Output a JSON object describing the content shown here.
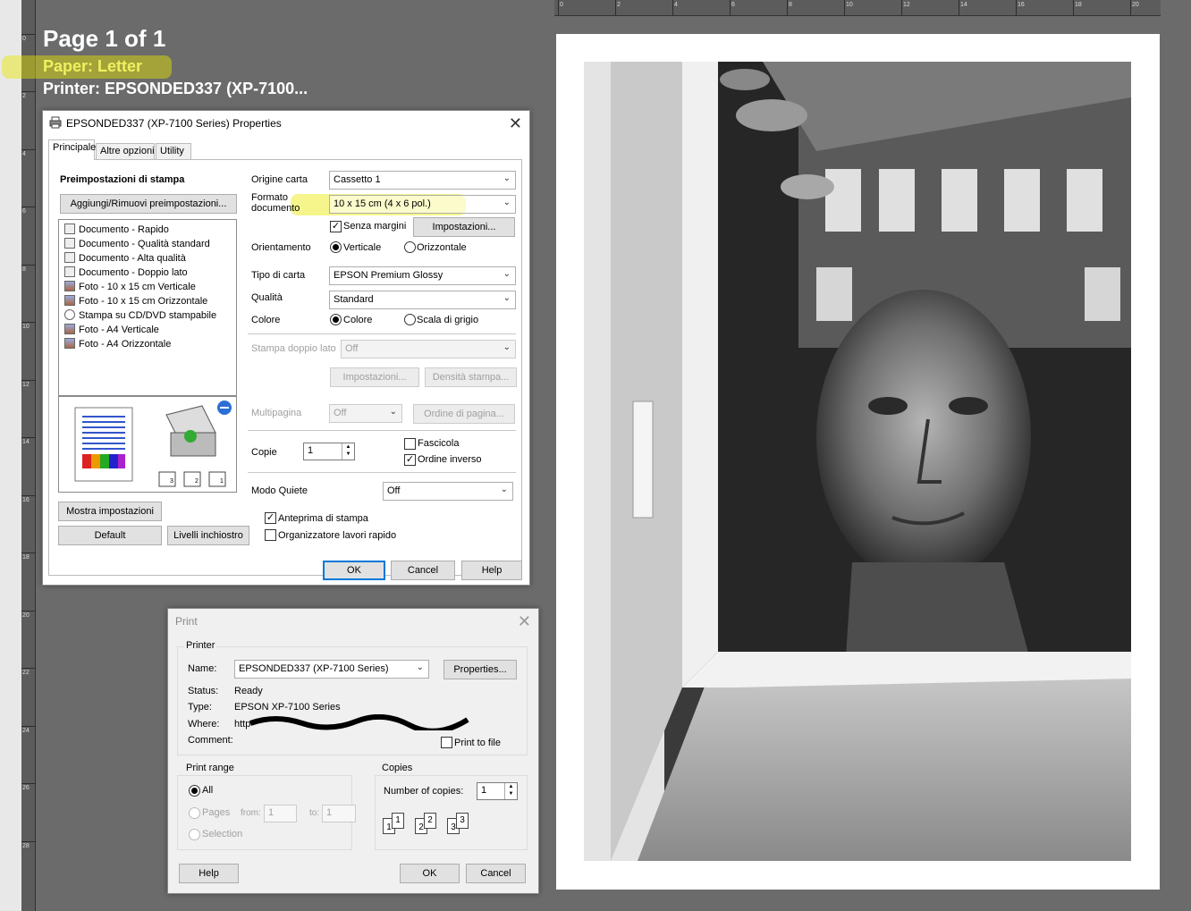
{
  "preview": {
    "page_info": "Page 1 of 1",
    "paper": "Paper:  Letter",
    "printer": "Printer:  EPSONDED337 (XP-7100..."
  },
  "vertical_ruler": [
    "0",
    "2",
    "4",
    "6",
    "8",
    "10",
    "12",
    "14",
    "16",
    "18",
    "20",
    "22",
    "24",
    "26",
    "28"
  ],
  "horizontal_ruler": [
    "0",
    "2",
    "4",
    "6",
    "8",
    "10",
    "12",
    "14",
    "16",
    "18",
    "20"
  ],
  "colors": {
    "highlight": "#e8e800",
    "accent": "#0078d7",
    "canvas": "#6b6b6b"
  },
  "properties": {
    "title": "EPSONDED337 (XP-7100 Series) Properties",
    "tabs": [
      "Principale",
      "Altre opzioni",
      "Utility"
    ],
    "presets_heading": "Preimpostazioni di stampa",
    "add_remove_button": "Aggiungi/Rimuovi preimpostazioni...",
    "presets": [
      {
        "label": "Documento - Rapido",
        "icon": "document-icon"
      },
      {
        "label": "Documento - Qualità standard",
        "icon": "document-icon"
      },
      {
        "label": "Documento - Alta qualità",
        "icon": "document-icon"
      },
      {
        "label": "Documento - Doppio lato",
        "icon": "document-icon"
      },
      {
        "label": "Foto - 10 x 15 cm Verticale",
        "icon": "photo-icon"
      },
      {
        "label": "Foto - 10 x 15 cm Orizzontale",
        "icon": "photo-icon"
      },
      {
        "label": "Stampa su CD/DVD stampabile",
        "icon": "cd-icon"
      },
      {
        "label": "Foto - A4 Verticale",
        "icon": "photo-icon"
      },
      {
        "label": "Foto - A4 Orizzontale",
        "icon": "photo-icon"
      }
    ],
    "paper_source_label": "Origine carta",
    "paper_source_value": "Cassetto 1",
    "doc_size_label_1": "Formato",
    "doc_size_label_2": "documento",
    "doc_size_value": "10 x 15 cm (4 x 6 pol.)",
    "borderless_label": "Senza margini",
    "borderless_checked": true,
    "settings_button": "Impostazioni...",
    "orientation_label": "Orientamento",
    "portrait_label": "Verticale",
    "landscape_label": "Orizzontale",
    "paper_type_label": "Tipo di carta",
    "paper_type_value": "EPSON Premium Glossy",
    "quality_label": "Qualità",
    "quality_value": "Standard",
    "color_label": "Colore",
    "color_option": "Colore",
    "grayscale_option": "Scala di grigio",
    "duplex_label": "Stampa doppio lato",
    "duplex_value": "Off",
    "duplex_settings_button": "Impostazioni...",
    "density_button": "Densità stampa...",
    "multipage_label": "Multipagina",
    "multipage_value": "Off",
    "page_order_button": "Ordine di pagina...",
    "copies_label": "Copie",
    "copies_value": "1",
    "collate_label": "Fascicola",
    "collate_checked": false,
    "reverse_order_label": "Ordine inverso",
    "reverse_order_checked": true,
    "quiet_mode_label": "Modo Quiete",
    "quiet_mode_value": "Off",
    "show_settings_button": "Mostra impostazioni",
    "default_button": "Default",
    "ink_levels_button": "Livelli inchiostro",
    "print_preview_label": "Anteprima di stampa",
    "print_preview_checked": true,
    "job_arranger_label": "Organizzatore lavori rapido",
    "job_arranger_checked": false,
    "ok_button": "OK",
    "cancel_button": "Cancel",
    "help_button": "Help"
  },
  "print": {
    "title": "Print",
    "printer_group": "Printer",
    "name_label": "Name:",
    "name_value": "EPSONDED337 (XP-7100 Series)",
    "properties_button": "Properties...",
    "status_label": "Status:",
    "status_value": "Ready",
    "type_label": "Type:",
    "type_value": "EPSON XP-7100 Series",
    "where_label": "Where:",
    "where_value": "http",
    "comment_label": "Comment:",
    "print_to_file_label": "Print to file",
    "range_group": "Print range",
    "all_label": "All",
    "pages_label": "Pages",
    "from_label": "from:",
    "from_value": "1",
    "to_label": "to:",
    "to_value": "1",
    "selection_label": "Selection",
    "copies_group": "Copies",
    "num_copies_label": "Number of copies:",
    "num_copies_value": "1",
    "collate_digits": [
      "1",
      "1",
      "2",
      "2",
      "3",
      "3"
    ],
    "help_button": "Help",
    "ok_button": "OK",
    "cancel_button": "Cancel"
  }
}
